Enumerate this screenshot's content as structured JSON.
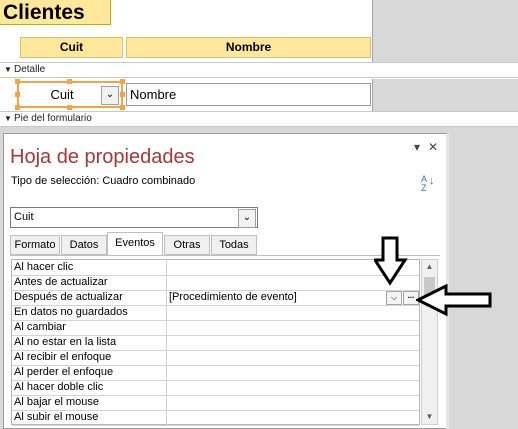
{
  "form": {
    "title": "Clientes",
    "headers": [
      "Cuit",
      "Nombre"
    ],
    "detail_band": "Detalle",
    "footer_band": "Pie del formulario",
    "combo_value": "Cuit",
    "name_value": "Nombre"
  },
  "property_sheet": {
    "title": "Hoja de propiedades",
    "selection_type_label": "Tipo de selección:",
    "selection_type_value": "Cuadro combinado",
    "object_selected": "Cuit",
    "tabs": [
      "Formato",
      "Datos",
      "Eventos",
      "Otras",
      "Todas"
    ],
    "active_tab": "Eventos",
    "events": [
      {
        "label": "Al hacer clic",
        "value": ""
      },
      {
        "label": "Antes de actualizar",
        "value": ""
      },
      {
        "label": "Después de actualizar",
        "value": "[Procedimiento de evento]"
      },
      {
        "label": "En datos no guardados",
        "value": ""
      },
      {
        "label": "Al cambiar",
        "value": ""
      },
      {
        "label": "Al no estar en la lista",
        "value": ""
      },
      {
        "label": "Al recibir el enfoque",
        "value": ""
      },
      {
        "label": "Al perder el enfoque",
        "value": ""
      },
      {
        "label": "Al hacer doble clic",
        "value": ""
      },
      {
        "label": "Al bajar el mouse",
        "value": ""
      },
      {
        "label": "Al subir el mouse",
        "value": ""
      }
    ],
    "dropdown_glyph": "⌵",
    "builder_glyph": "...",
    "sort_icon_top": "A",
    "sort_icon_bottom": "Z"
  },
  "colors": {
    "header_fill": "#ffe79c",
    "selection_outline": "#f4a543",
    "sheet_title": "#a4373a"
  }
}
